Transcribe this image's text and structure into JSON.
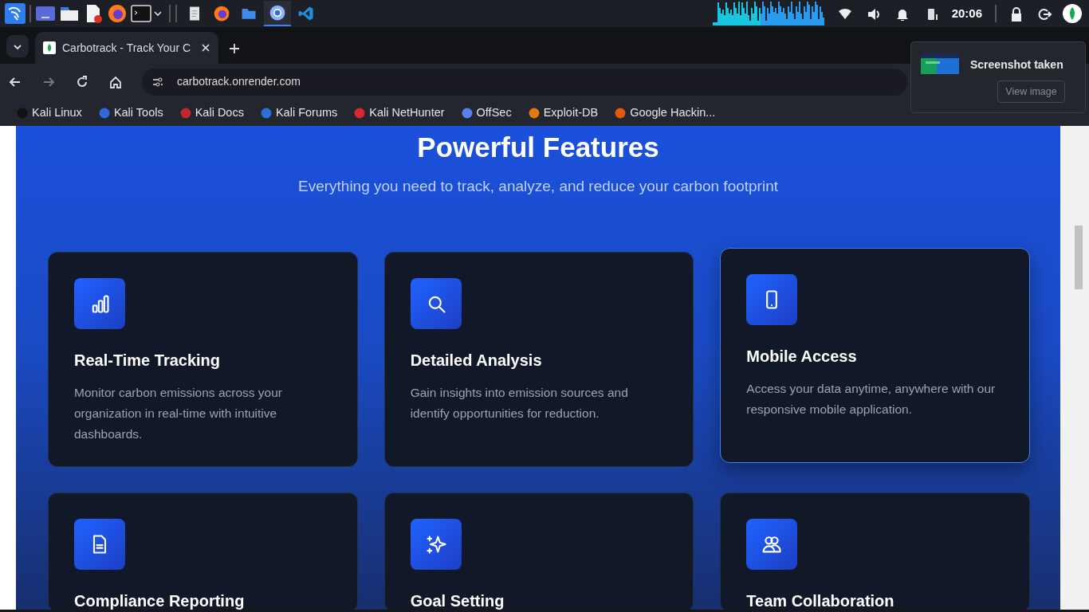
{
  "taskbar": {
    "launchers": [
      {
        "kind": "kali"
      },
      {
        "kind": "desktop"
      },
      {
        "kind": "files"
      },
      {
        "kind": "editor"
      },
      {
        "kind": "firefox"
      },
      {
        "kind": "terminal"
      }
    ],
    "tasks": [
      {
        "kind": "document",
        "selected": false
      },
      {
        "kind": "firefox",
        "selected": false
      },
      {
        "kind": "folder",
        "selected": false
      },
      {
        "kind": "chromium",
        "selected": true
      },
      {
        "kind": "vscode",
        "selected": false
      }
    ],
    "clock": "20:06"
  },
  "browser": {
    "tabs": [
      {
        "title": "Carbotrack - Track Your C",
        "selected": true
      }
    ],
    "url": "carbotrack.onrender.com",
    "bookmarks": [
      {
        "label": "Kali Linux"
      },
      {
        "label": "Kali Tools"
      },
      {
        "label": "Kali Docs"
      },
      {
        "label": "Kali Forums"
      },
      {
        "label": "Kali NetHunter"
      },
      {
        "label": "OffSec"
      },
      {
        "label": "Exploit-DB"
      },
      {
        "label": "Google Hackin..."
      }
    ]
  },
  "notification": {
    "title": "Screenshot taken",
    "button": "View image"
  },
  "page": {
    "heading": "Powerful Features",
    "subheading": "Everything you need to track, analyze, and reduce your carbon footprint",
    "features": [
      {
        "kind": "chart",
        "title": "Real-Time Tracking",
        "description": "Monitor carbon emissions across your organization in real-time with intuitive dashboards.",
        "highlighted": false
      },
      {
        "kind": "search",
        "title": "Detailed Analysis",
        "description": "Gain insights into emission sources and identify opportunities for reduction.",
        "highlighted": false
      },
      {
        "kind": "phone",
        "title": "Mobile Access",
        "description": "Access your data anytime, anywhere with our responsive mobile application.",
        "highlighted": true
      },
      {
        "kind": "document",
        "title": "Compliance Reporting",
        "highlighted": false
      },
      {
        "kind": "sparkles",
        "title": "Goal Setting",
        "highlighted": false
      },
      {
        "kind": "users",
        "title": "Team Collaboration",
        "highlighted": false
      }
    ]
  }
}
